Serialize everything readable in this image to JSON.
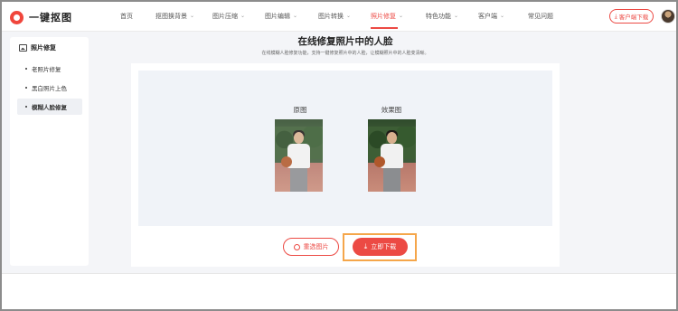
{
  "header": {
    "logo_text": "一键抠图",
    "nav": [
      {
        "label": "首页",
        "chevron": false,
        "active": false
      },
      {
        "label": "抠图换背景",
        "chevron": true,
        "active": false
      },
      {
        "label": "图片压缩",
        "chevron": true,
        "active": false
      },
      {
        "label": "图片编辑",
        "chevron": true,
        "active": false
      },
      {
        "label": "图片转换",
        "chevron": true,
        "active": false
      },
      {
        "label": "照片修复",
        "chevron": true,
        "active": true
      },
      {
        "label": "特色功能",
        "chevron": true,
        "active": false
      },
      {
        "label": "客户端",
        "chevron": true,
        "active": false
      },
      {
        "label": "常见问题",
        "chevron": false,
        "active": false
      }
    ],
    "client_download": "客户端下载",
    "accent_color": "#ec4a44"
  },
  "sidebar": {
    "title": "照片修复",
    "items": [
      {
        "label": "老照片修复",
        "active": false
      },
      {
        "label": "黑白照片上色",
        "active": false
      },
      {
        "label": "模糊人脸修复",
        "active": true
      }
    ]
  },
  "main": {
    "title": "在线修复照片中的人脸",
    "subtitle": "在线模糊人脸修复功能，支持一键修复照片中的人脸，让模糊照片中的人脸变清晰。",
    "original_label": "原图",
    "result_label": "效果图",
    "reselect_label": "重选图片",
    "download_label": "立即下载"
  }
}
